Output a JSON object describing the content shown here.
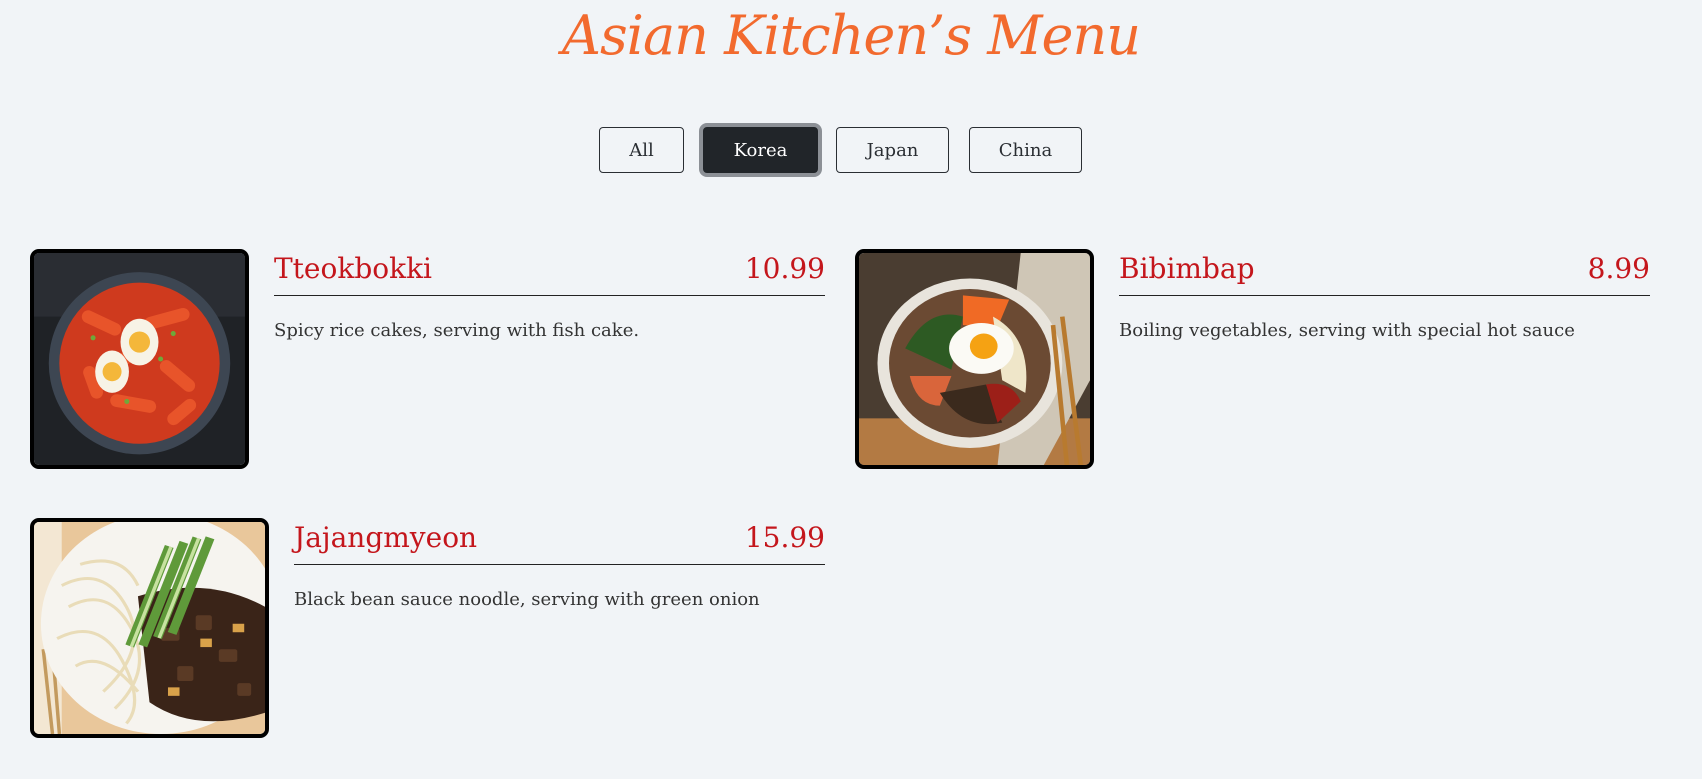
{
  "header": {
    "title": "Asian Kitchen’s Menu"
  },
  "filters": {
    "items": [
      {
        "label": "All"
      },
      {
        "label": "Korea",
        "active": true
      },
      {
        "label": "Japan"
      },
      {
        "label": "China"
      }
    ]
  },
  "menu": {
    "items": [
      {
        "name": "Tteokbokki",
        "price": "10.99",
        "description": "Spicy rice cakes, serving with fish cake."
      },
      {
        "name": "Bibimbap",
        "price": "8.99",
        "description": "Boiling vegetables, serving with special hot sauce"
      },
      {
        "name": "Jajangmyeon",
        "price": "15.99",
        "description": "Black bean sauce noodle, serving with green onion"
      }
    ]
  },
  "colors": {
    "title": "#f26a2e",
    "item_text": "#c4161c",
    "active_filter": "#212529",
    "background": "#f1f4f7"
  }
}
